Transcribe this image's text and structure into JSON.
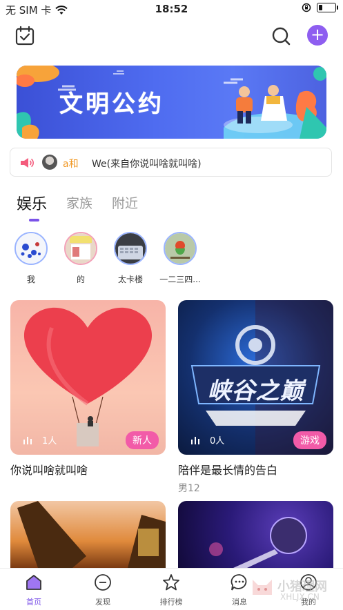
{
  "status_bar": {
    "carrier": "无 SIM 卡",
    "time": "18:52"
  },
  "banner": {
    "title": "文明公约"
  },
  "notice": {
    "user": "a和",
    "message": "We(来自你说叫啥就叫啥)"
  },
  "tabs": [
    {
      "label": "娱乐",
      "active": true
    },
    {
      "label": "家族",
      "active": false
    },
    {
      "label": "附近",
      "active": false
    }
  ],
  "circles": [
    {
      "label": "我"
    },
    {
      "label": "的"
    },
    {
      "label": "太卡楼"
    },
    {
      "label": "一二三四..."
    }
  ],
  "rooms": [
    {
      "title": "你说叫啥就叫啥",
      "listeners": "1人",
      "badge": "新人",
      "sub": "",
      "art_text": ""
    },
    {
      "title": "陪伴是最长情的告白",
      "listeners": "0人",
      "badge": "游戏",
      "sub": "男12",
      "art_text": "峡谷之巅"
    }
  ],
  "bottom_nav": [
    {
      "label": "首页",
      "icon": "home-icon",
      "active": true
    },
    {
      "label": "发现",
      "icon": "discover-icon",
      "active": false
    },
    {
      "label": "排行榜",
      "icon": "star-icon",
      "active": false
    },
    {
      "label": "消息",
      "icon": "message-icon",
      "active": false
    },
    {
      "label": "我的",
      "icon": "profile-icon",
      "active": false
    }
  ],
  "watermark": {
    "text": "小猪理网",
    "url": "XHLJX.CN"
  },
  "colors": {
    "accent": "#7b53e8",
    "badge": "#f25ba8",
    "notice_name": "#f0951e"
  }
}
